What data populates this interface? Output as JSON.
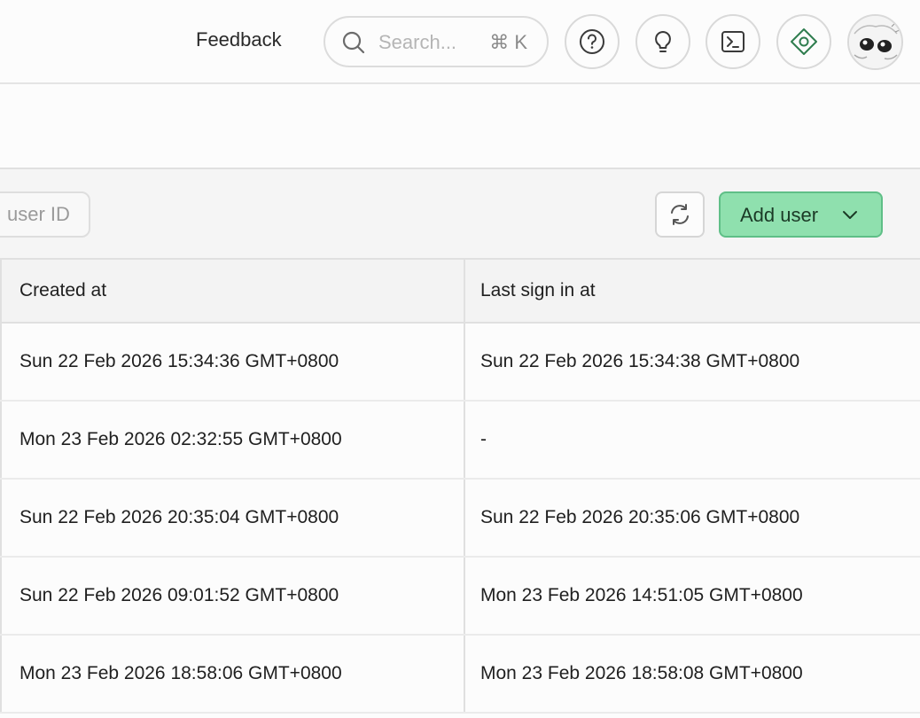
{
  "topbar": {
    "feedback_label": "Feedback",
    "search": {
      "placeholder": "Search...",
      "shortcut": "⌘ K"
    },
    "icons": [
      "help-icon",
      "lightbulb-icon",
      "terminal-icon",
      "diamond-icon"
    ],
    "accent_color": "#2f7d4f"
  },
  "toolbar": {
    "id_input_placeholder": "user ID",
    "add_user_label": "Add user",
    "add_user_color": "#8fe0ae"
  },
  "table": {
    "columns": [
      "Created at",
      "Last sign in at"
    ],
    "rows": [
      {
        "created_at": "Sun 22 Feb 2026 15:34:36 GMT+0800",
        "last_sign_in": "Sun 22 Feb 2026 15:34:38 GMT+0800"
      },
      {
        "created_at": "Mon 23 Feb 2026 02:32:55 GMT+0800",
        "last_sign_in": "-"
      },
      {
        "created_at": "Sun 22 Feb 2026 20:35:04 GMT+0800",
        "last_sign_in": "Sun 22 Feb 2026 20:35:06 GMT+0800"
      },
      {
        "created_at": "Sun 22 Feb 2026 09:01:52 GMT+0800",
        "last_sign_in": "Mon 23 Feb 2026 14:51:05 GMT+0800"
      },
      {
        "created_at": "Mon 23 Feb 2026 18:58:06 GMT+0800",
        "last_sign_in": "Mon 23 Feb 2026 18:58:08 GMT+0800"
      }
    ]
  }
}
